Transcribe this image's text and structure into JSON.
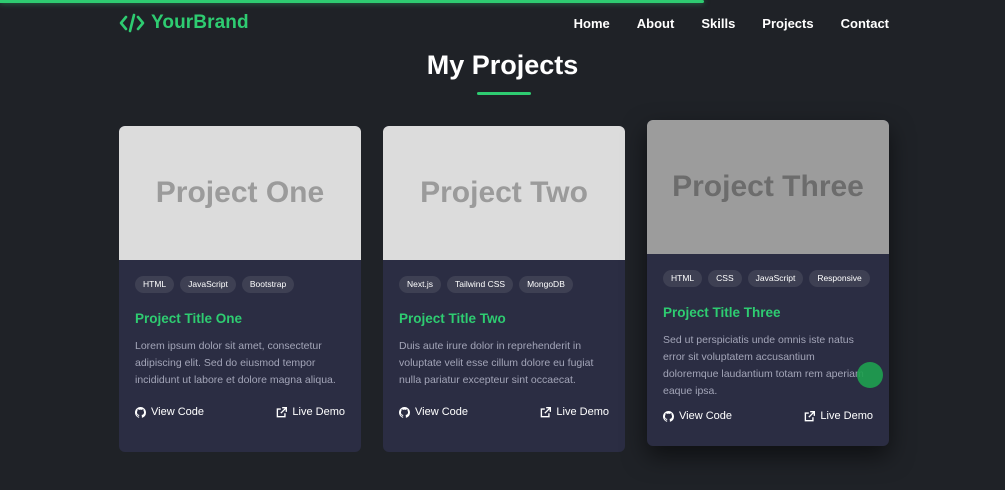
{
  "page": {
    "scroll_progress_percent": 70,
    "accent_color": "#2ecc71"
  },
  "brand": {
    "icon": "code-brackets-icon",
    "name": "YourBrand"
  },
  "nav": {
    "links": [
      "Home",
      "About",
      "Skills",
      "Projects",
      "Contact"
    ]
  },
  "section": {
    "title": "My Projects"
  },
  "projects": [
    {
      "image_text": "Project One",
      "tags": [
        "HTML",
        "JavaScript",
        "Bootstrap"
      ],
      "title": "Project Title One",
      "description": "Lorem ipsum dolor sit amet, consectetur adipiscing elit. Sed do eiusmod tempor incididunt ut labore et dolore magna aliqua.",
      "code_label": "View Code",
      "code_icon": "github-icon",
      "demo_label": "Live Demo",
      "demo_icon": "external-link-icon"
    },
    {
      "image_text": "Project Two",
      "tags": [
        "Next.js",
        "Tailwind CSS",
        "MongoDB"
      ],
      "title": "Project Title Two",
      "description": "Duis aute irure dolor in reprehenderit in voluptate velit esse cillum dolore eu fugiat nulla pariatur excepteur sint occaecat.",
      "code_label": "View Code",
      "code_icon": "github-icon",
      "demo_label": "Live Demo",
      "demo_icon": "external-link-icon"
    },
    {
      "image_text": "Project Three",
      "tags": [
        "HTML",
        "CSS",
        "JavaScript",
        "Responsive"
      ],
      "title": "Project Title Three",
      "description": "Sed ut perspiciatis unde omnis iste natus error sit voluptatem accusantium doloremque laudantium totam rem aperiam eaque ipsa.",
      "code_label": "View Code",
      "code_icon": "github-icon",
      "demo_label": "Live Demo",
      "demo_icon": "external-link-icon"
    }
  ]
}
